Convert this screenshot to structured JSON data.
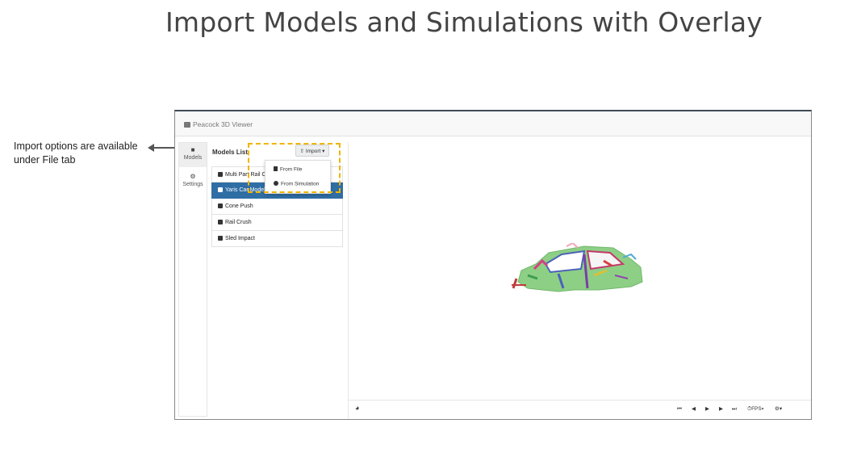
{
  "slide": {
    "title": "Import Models and Simulations with Overlay",
    "callout": "Import options are available under File tab"
  },
  "app": {
    "title": "Peacock 3D Viewer",
    "sidebar": {
      "tabs": [
        {
          "label": "Models",
          "icon": "cube-icon"
        },
        {
          "label": "Settings",
          "icon": "gear-icon"
        }
      ]
    },
    "models_panel": {
      "heading": "Models List",
      "import_button": "Import",
      "items": [
        {
          "label": "Multi Part Rail Crush"
        },
        {
          "label": "Yaris Car Model"
        },
        {
          "label": "Cone Push"
        },
        {
          "label": "Rail Crush"
        },
        {
          "label": "Sled Impact"
        }
      ],
      "selected": "Yaris Car Model",
      "dropdown": {
        "from_file": "From File",
        "from_simulation": "From Simulation"
      }
    },
    "toolbar": {
      "fps_label": "FPS",
      "icons": [
        "skip-to-start-icon",
        "step-back-icon",
        "play-icon",
        "step-forward-icon",
        "skip-to-end-icon"
      ]
    }
  },
  "colors": {
    "selected_item": "#2f6ea5",
    "highlight": "#f0b400",
    "car_body": "#8ecf86"
  }
}
